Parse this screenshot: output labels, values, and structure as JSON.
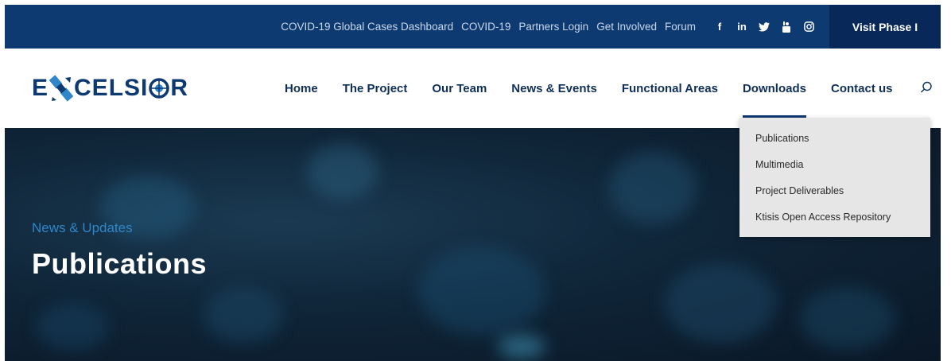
{
  "topbar": {
    "links": [
      "COVID-19 Global Cases Dashboard",
      "COVID-19",
      "Partners Login",
      "Get Involved",
      "Forum"
    ],
    "social": [
      "f",
      "in",
      "twitter",
      "youtube",
      "instagram"
    ],
    "visit_label": "Visit Phase I"
  },
  "header": {
    "logo_text_1": "E",
    "logo_text_2": "CELSI",
    "logo_text_3": "R",
    "nav": [
      "Home",
      "The Project",
      "Our Team",
      "News & Events",
      "Functional Areas",
      "Downloads",
      "Contact us"
    ],
    "active_nav": "Downloads"
  },
  "hero": {
    "subtitle": "News & Updates",
    "title": "Publications"
  },
  "dropdown": {
    "items": [
      "Publications",
      "Multimedia",
      "Project Deliverables",
      "Ktisis Open Access Repository"
    ]
  },
  "colors": {
    "brand": "#0e3a72",
    "visit_bg": "#08285a",
    "hero_subtitle": "#2f86c9"
  }
}
